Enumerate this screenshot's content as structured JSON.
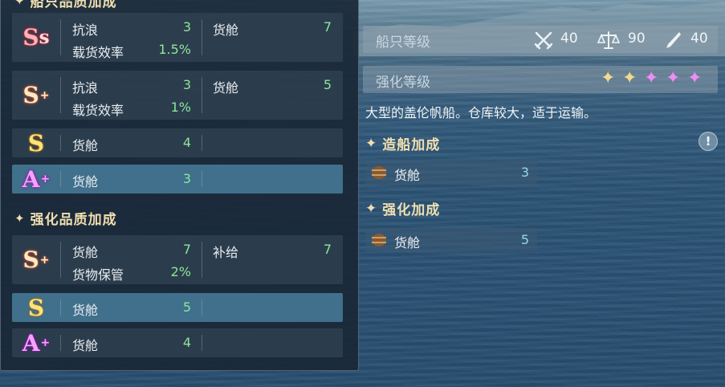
{
  "quality_panel": {
    "section_title_top": "船只品质加成",
    "rows": [
      {
        "grade": "SS",
        "stats": [
          {
            "label": "抗浪",
            "value": "3"
          },
          {
            "label": "载货效率",
            "value": "1.5%"
          },
          {
            "label": "货舱",
            "value": "7"
          }
        ]
      },
      {
        "grade": "S+",
        "stats": [
          {
            "label": "抗浪",
            "value": "3"
          },
          {
            "label": "载货效率",
            "value": "1%"
          },
          {
            "label": "货舱",
            "value": "5"
          }
        ]
      },
      {
        "grade": "S",
        "stats": [
          {
            "label": "货舱",
            "value": "4"
          }
        ]
      },
      {
        "grade": "A+",
        "stats": [
          {
            "label": "货舱",
            "value": "3"
          }
        ]
      }
    ],
    "enhance_title": "强化品质加成",
    "enhance_rows": [
      {
        "grade": "S+",
        "stats": [
          {
            "label": "货舱",
            "value": "7"
          },
          {
            "label": "货物保管",
            "value": "2%"
          },
          {
            "label": "补给",
            "value": "7"
          }
        ]
      },
      {
        "grade": "S",
        "stats": [
          {
            "label": "货舱",
            "value": "5"
          }
        ]
      },
      {
        "grade": "A+",
        "stats": [
          {
            "label": "货舱",
            "value": "4"
          }
        ]
      }
    ]
  },
  "ship_info": {
    "level_label": "船只等级",
    "attack_value": "40",
    "balance_value": "90",
    "durability_value": "40",
    "enhance_label": "强化等级",
    "enhance_stars": {
      "filled_gold": 2,
      "filled_pink": 3,
      "total": 5
    },
    "description": "大型的盖伦帆船。仓库较大，适于运输。",
    "build_bonus_title": "造船加成",
    "build_bonus": {
      "label": "货舱",
      "value": "3"
    },
    "enhance_bonus_title": "强化加成",
    "enhance_bonus": {
      "label": "货舱",
      "value": "5"
    },
    "info_glyph": "!"
  },
  "colors": {
    "gold_star": "#f5d98a",
    "pink_star": "#f08cf5",
    "stat_green": "#8ee69a",
    "header_gold": "#f1dfb0"
  }
}
